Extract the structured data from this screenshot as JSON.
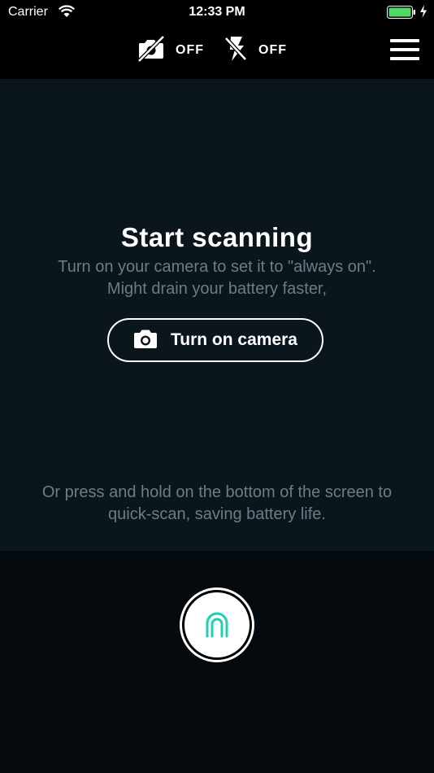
{
  "status_bar": {
    "carrier": "Carrier",
    "time": "12:33 PM",
    "battery_color": "#4cd964"
  },
  "toolbar": {
    "camera_toggle": {
      "icon": "camera-off-icon",
      "label": "OFF"
    },
    "flash_toggle": {
      "icon": "flash-off-icon",
      "label": "OFF"
    },
    "menu_icon": "hamburger-menu-icon"
  },
  "main": {
    "title": "Start scanning",
    "subtitle": "Turn on your camera to set it to \"always on\". Might drain your battery faster,",
    "camera_button": {
      "icon": "camera-icon",
      "label": "Turn on camera"
    },
    "hint": "Or press and hold on the bottom of the screen to quick-scan, saving battery life."
  },
  "scan": {
    "icon": "fingerprint-arch-icon",
    "accent_color": "#1fd1b0"
  }
}
